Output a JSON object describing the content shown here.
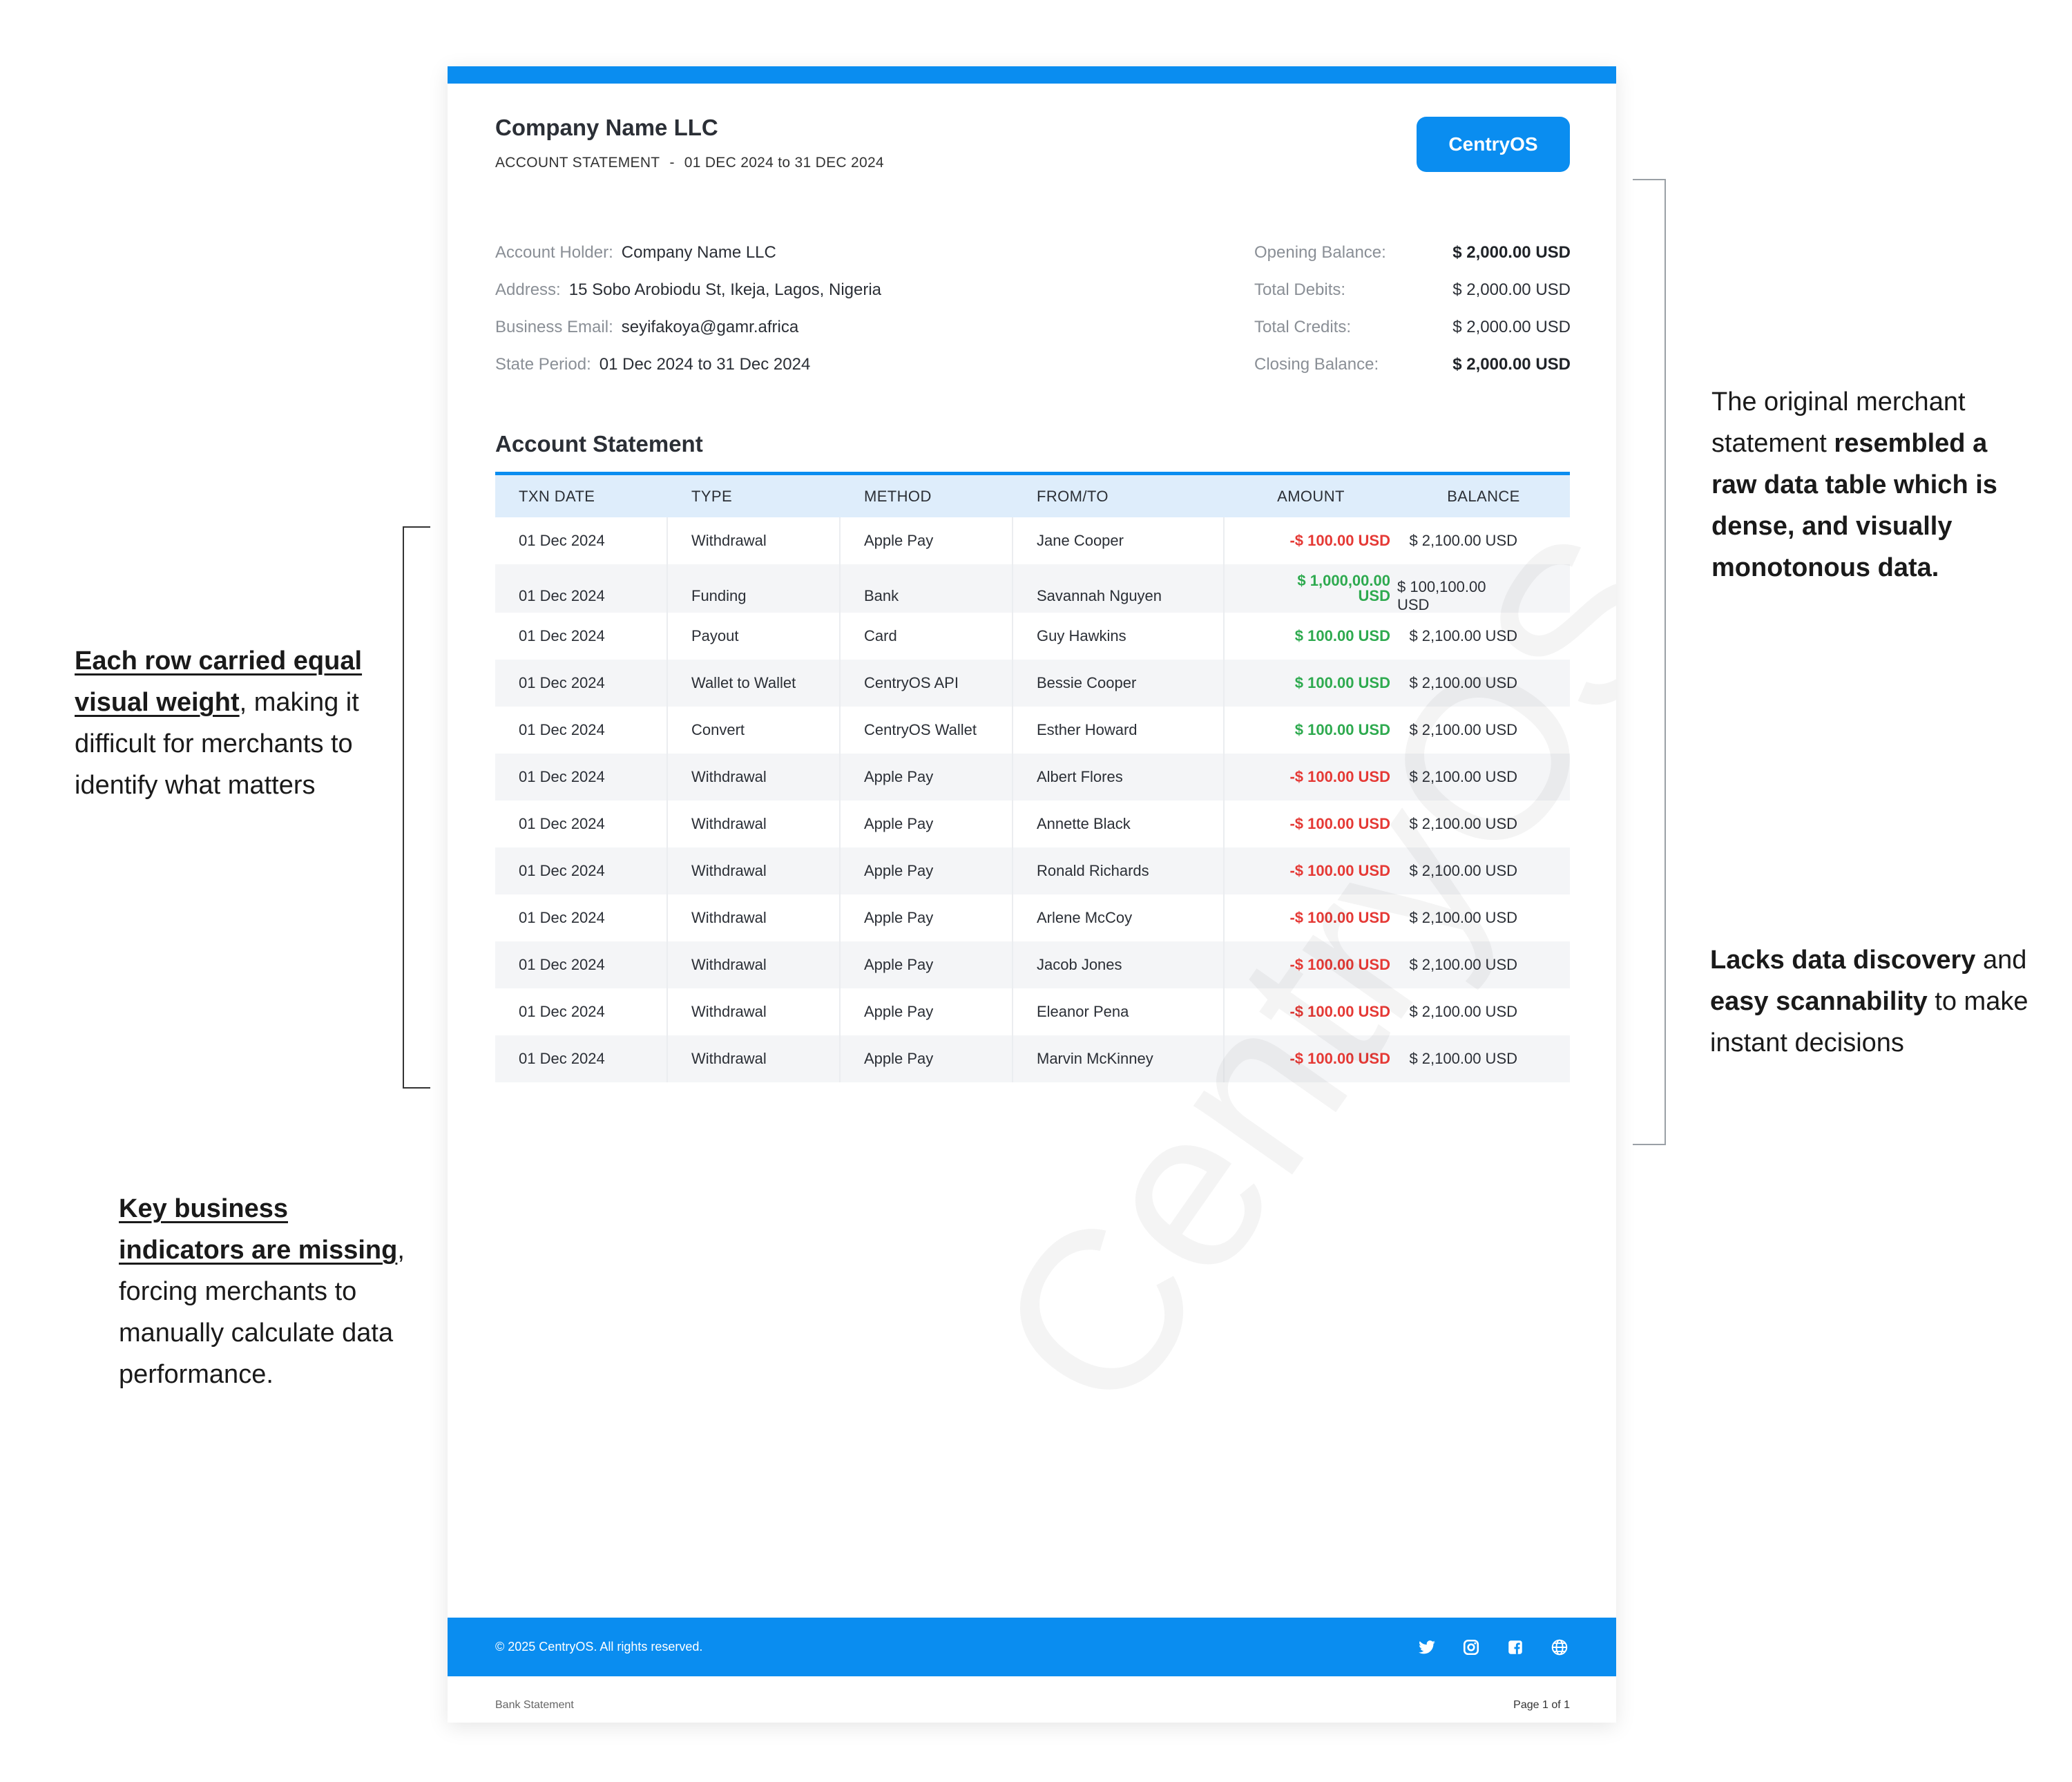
{
  "statement": {
    "company_name": "Company Name LLC",
    "subtitle_label": "ACCOUNT STATEMENT",
    "subtitle_sep": "-",
    "subtitle_period": "01 DEC 2024 to 31 DEC 2024",
    "brand_button": "CentryOS",
    "account_info": [
      {
        "label": "Account Holder:",
        "value": "Company Name LLC"
      },
      {
        "label": "Address:",
        "value": "15 Sobo Arobiodu St, Ikeja, Lagos, Nigeria"
      },
      {
        "label": "Business Email:",
        "value": "seyifakoya@gamr.africa"
      },
      {
        "label": "State Period:",
        "value": "01 Dec 2024 to 31 Dec 2024"
      }
    ],
    "balances": [
      {
        "label": "Opening Balance:",
        "value": "$ 2,000.00 USD"
      },
      {
        "label": "Total Debits:",
        "value": "$ 2,000.00 USD"
      },
      {
        "label": "Total Credits:",
        "value": "$ 2,000.00 USD"
      },
      {
        "label": "Closing Balance:",
        "value": "$ 2,000.00 USD"
      }
    ],
    "section_title": "Account Statement",
    "table": {
      "headers": [
        "TXN DATE",
        "TYPE",
        "METHOD",
        "FROM/TO",
        "AMOUNT",
        "BALANCE"
      ],
      "rows": [
        {
          "date": "01 Dec 2024",
          "type": "Withdrawal",
          "method": "Apple Pay",
          "party": "Jane Cooper",
          "amount": "-$ 100.00 USD",
          "balance": "$ 2,100.00 USD"
        },
        {
          "date": "01 Dec 2024",
          "type": "Funding",
          "method": "Bank",
          "party": "Savannah Nguyen",
          "amount_line1": "$ 1,000,00.00",
          "amount_line2": "USD",
          "balance": "$ 100,100.00 USD"
        },
        {
          "date": "01 Dec 2024",
          "type": "Payout",
          "method": "Card",
          "party": "Guy Hawkins",
          "amount": "$ 100.00 USD",
          "balance": "$ 2,100.00 USD"
        },
        {
          "date": "01 Dec 2024",
          "type": "Wallet to Wallet",
          "method": "CentryOS API",
          "party": "Bessie Cooper",
          "amount": "$ 100.00 USD",
          "balance": "$ 2,100.00 USD"
        },
        {
          "date": "01 Dec 2024",
          "type": "Convert",
          "method": "CentryOS Wallet",
          "party": "Esther Howard",
          "amount": "$ 100.00 USD",
          "balance": "$ 2,100.00 USD"
        },
        {
          "date": "01 Dec 2024",
          "type": "Withdrawal",
          "method": "Apple Pay",
          "party": "Albert Flores",
          "amount": "-$ 100.00 USD",
          "balance": "$ 2,100.00 USD"
        },
        {
          "date": "01 Dec 2024",
          "type": "Withdrawal",
          "method": "Apple Pay",
          "party": "Annette Black",
          "amount": "-$ 100.00 USD",
          "balance": "$ 2,100.00 USD"
        },
        {
          "date": "01 Dec 2024",
          "type": "Withdrawal",
          "method": "Apple Pay",
          "party": "Ronald Richards",
          "amount": "-$ 100.00 USD",
          "balance": "$ 2,100.00 USD"
        },
        {
          "date": "01 Dec 2024",
          "type": "Withdrawal",
          "method": "Apple Pay",
          "party": "Arlene McCoy",
          "amount": "-$ 100.00 USD",
          "balance": "$ 2,100.00 USD"
        },
        {
          "date": "01 Dec 2024",
          "type": "Withdrawal",
          "method": "Apple Pay",
          "party": "Jacob Jones",
          "amount": "-$ 100.00 USD",
          "balance": "$ 2,100.00 USD"
        },
        {
          "date": "01 Dec 2024",
          "type": "Withdrawal",
          "method": "Apple Pay",
          "party": "Eleanor Pena",
          "amount": "-$ 100.00 USD",
          "balance": "$ 2,100.00 USD"
        },
        {
          "date": "01 Dec 2024",
          "type": "Withdrawal",
          "method": "Apple Pay",
          "party": "Marvin McKinney",
          "amount": "-$ 100.00 USD",
          "balance": "$ 2,100.00 USD"
        }
      ]
    },
    "watermark": "CentryOS",
    "footer_copyright": "© 2025 CentryOS. All rights reserved.",
    "social_icons": [
      "twitter-icon",
      "instagram-icon",
      "facebook-icon",
      "globe-icon"
    ],
    "doc_label": "Bank Statement",
    "page_label": "Page 1 of 1"
  },
  "colors": {
    "brand_blue": "#0a8df0",
    "negative": "#e53935",
    "positive": "#2eaa4f",
    "header_row": "#deedfb"
  },
  "annotations": {
    "left_top": {
      "emphasis": "Each row carried equal visual weight",
      "rest": ", making it difficult for merchants to identify what matters"
    },
    "left_bottom": {
      "emphasis": "Key business indicators are missing",
      "rest": ", forcing merchants to manually calculate data performance."
    },
    "right_top": {
      "plain": "The original merchant statement ",
      "bold": "resembled a raw data table which is dense, and visually monotonous data."
    },
    "right_bottom": {
      "bold1": "Lacks data discovery",
      "plain1": " and ",
      "bold2": "easy scannability",
      "plain2": " to make instant decisions"
    }
  }
}
